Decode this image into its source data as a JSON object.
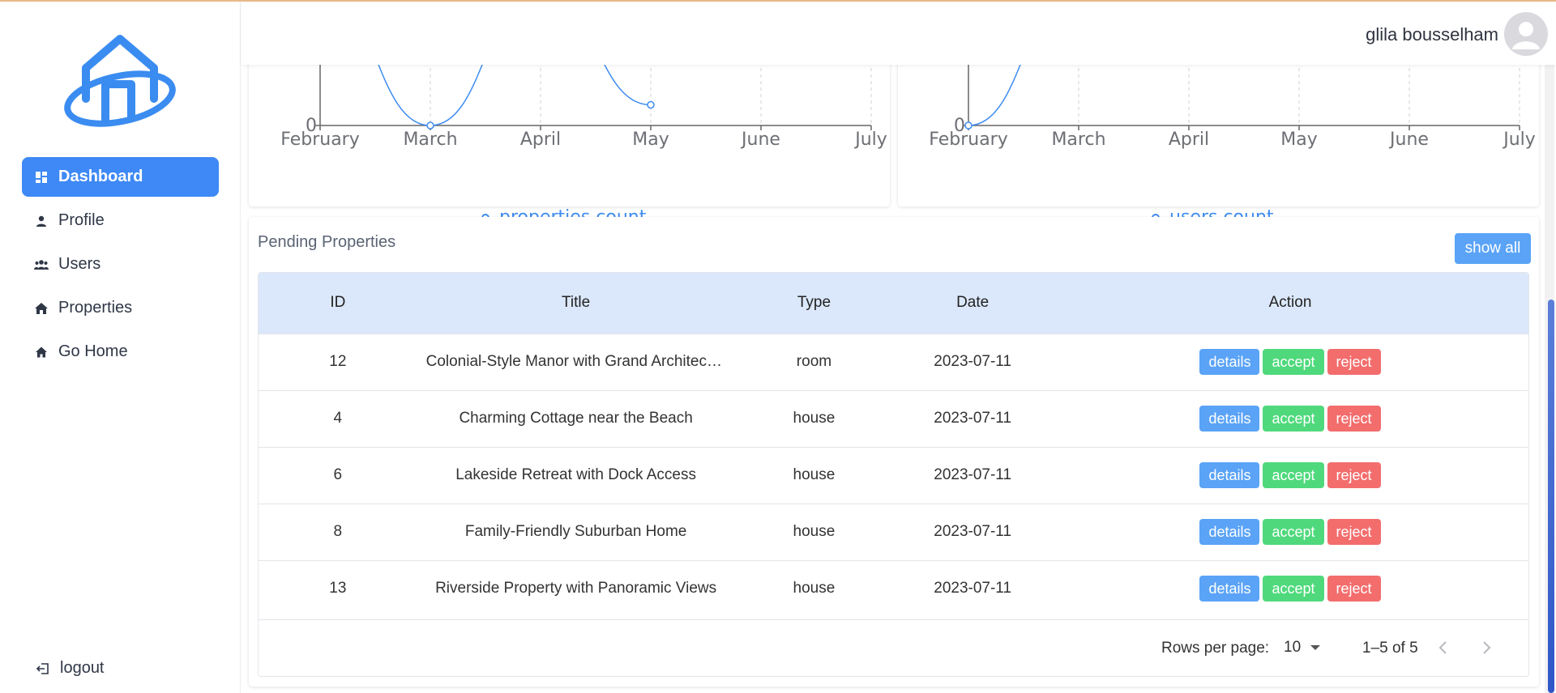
{
  "user": {
    "name": "glila bousselham"
  },
  "nav": {
    "items": [
      {
        "label": "Dashboard",
        "icon": "dashboard-icon",
        "active": true
      },
      {
        "label": "Profile",
        "icon": "person-icon",
        "active": false
      },
      {
        "label": "Users",
        "icon": "users-icon",
        "active": false
      },
      {
        "label": "Properties",
        "icon": "house-icon",
        "active": false
      },
      {
        "label": "Go Home",
        "icon": "home-icon",
        "active": false
      }
    ],
    "logout": "logout"
  },
  "chart_data": [
    {
      "type": "line",
      "categories": [
        "February",
        "March",
        "April",
        "May",
        "June",
        "July"
      ],
      "series": [
        {
          "name": "properties count",
          "values": [
            2,
            0,
            2,
            0.3,
            null,
            null
          ]
        }
      ],
      "y_tick_labels": [
        "0"
      ],
      "legend": "bottom-center",
      "grid": "vertical-dashed",
      "color": "#3e8cf0"
    },
    {
      "type": "line",
      "categories": [
        "February",
        "March",
        "April",
        "May",
        "June",
        "July"
      ],
      "series": [
        {
          "name": "users count",
          "values": [
            0,
            2,
            null,
            null,
            null,
            null
          ]
        }
      ],
      "y_tick_labels": [
        "0"
      ],
      "legend": "bottom-center",
      "grid": "vertical-dashed",
      "color": "#3e8cf0"
    }
  ],
  "pending": {
    "title": "Pending Properties",
    "show_all": "show all",
    "columns": [
      "ID",
      "Title",
      "Type",
      "Date",
      "Action"
    ],
    "rows": [
      {
        "id": "12",
        "title": "Colonial-Style Manor with Grand Architecture",
        "type": "room",
        "date": "2023-07-11"
      },
      {
        "id": "4",
        "title": "Charming Cottage near the Beach",
        "type": "house",
        "date": "2023-07-11"
      },
      {
        "id": "6",
        "title": "Lakeside Retreat with Dock Access",
        "type": "house",
        "date": "2023-07-11"
      },
      {
        "id": "8",
        "title": "Family-Friendly Suburban Home",
        "type": "house",
        "date": "2023-07-11"
      },
      {
        "id": "13",
        "title": "Riverside Property with Panoramic Views",
        "type": "house",
        "date": "2023-07-11"
      }
    ],
    "actions": {
      "details": "details",
      "accept": "accept",
      "reject": "reject"
    },
    "pagination": {
      "rows_per_page_label": "Rows per page:",
      "rows_per_page": "10",
      "range": "1–5 of 5"
    }
  },
  "colors": {
    "primary": "#3e89f5",
    "details": "#5aa3f6",
    "accept": "#4fd97c",
    "reject": "#f36d6d",
    "header_row": "#dbe8fb"
  }
}
